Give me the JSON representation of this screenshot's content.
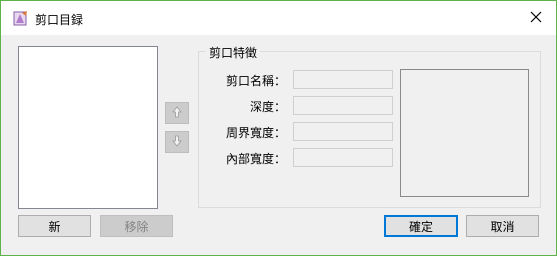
{
  "window": {
    "title": "剪口目録",
    "icon": "app-icon",
    "close_icon": "close-icon",
    "accent_color": "#5fb14a"
  },
  "list": {
    "items": [],
    "move_up_icon": "arrow-up-icon",
    "move_down_icon": "arrow-down-icon"
  },
  "group": {
    "title": "剪口特徵",
    "fields": [
      {
        "label": "剪口名稱：",
        "value": ""
      },
      {
        "label": "深度：",
        "value": ""
      },
      {
        "label": "周界寬度：",
        "value": ""
      },
      {
        "label": "內部寬度：",
        "value": ""
      }
    ]
  },
  "buttons": {
    "new": "新",
    "remove": "移除",
    "ok": "確定",
    "cancel": "取消"
  }
}
